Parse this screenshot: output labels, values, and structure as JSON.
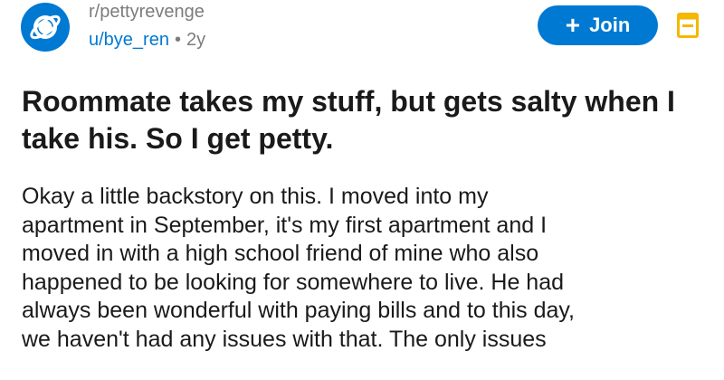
{
  "post": {
    "subreddit": "r/pettyrevenge",
    "author": "u/bye_ren",
    "separator": "•",
    "age": "2y",
    "join_label": "Join",
    "join_icon": "+",
    "title": "Roommate takes my stuff, but gets salty when I take his. So I get petty.",
    "body_lines": [
      "Okay a little backstory on this. I moved into my",
      "apartment in September, it's my first apartment and I",
      "moved in with a high school friend of mine who also",
      "happened to be looking for somewhere to live. He had",
      "always been wonderful with paying bills and to this day,",
      "we haven't had any issues with that. The only issues"
    ]
  },
  "colors": {
    "accent": "#0079d3",
    "save_icon": "#f5b700",
    "meta_text": "#7c7c7c",
    "body_text": "#1a1a1b"
  },
  "icons": {
    "avatar": "planet-icon",
    "join": "plus-icon",
    "save": "save-icon"
  }
}
